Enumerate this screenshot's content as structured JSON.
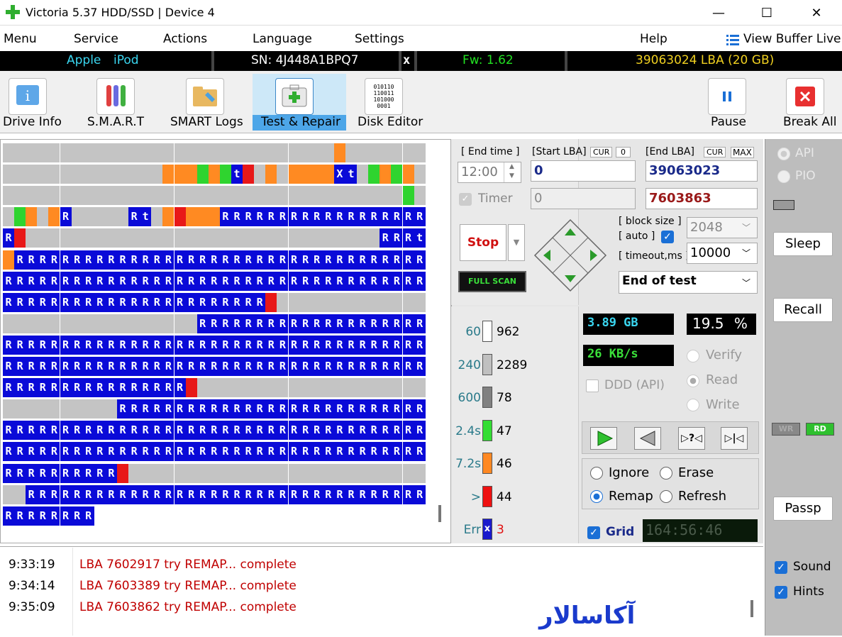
{
  "window": {
    "title": "Victoria 5.37 HDD/SSD | Device 4",
    "minimize": "—",
    "maximize": "☐",
    "close": "✕"
  },
  "menu": {
    "items": [
      "Menu",
      "Service",
      "Actions",
      "Language",
      "Settings",
      "Help"
    ],
    "view_buffer": "View Buffer Live"
  },
  "drive": {
    "vendor": "Apple",
    "model": "iPod",
    "serial": "SN: 4J448A1BPQ7",
    "close_x": "x",
    "firmware": "Fw: 1.62",
    "capacity": "39063024 LBA (20 GB)"
  },
  "toolbar": {
    "drive_info": "Drive Info",
    "smart": "S.M.A.R.T",
    "smart_logs": "SMART Logs",
    "test_repair": "Test & Repair",
    "disk_editor": "Disk Editor",
    "pause": "Pause",
    "break_all": "Break All",
    "disk_editor_icon_text": [
      "010110",
      "110011",
      "101000",
      "0001"
    ]
  },
  "controls": {
    "end_time_label": "[ End time ]",
    "end_time_value": "12:00",
    "timer_label": "Timer",
    "timer_value": "0",
    "start_lba_label": "[Start LBA]",
    "cur_label": "CUR",
    "cur_value": "0",
    "start_lba_value": "0",
    "end_lba_label": "[End LBA]",
    "end_cur_label": "CUR",
    "max_label": "MAX",
    "end_lba_value": "39063023",
    "current_lba_value": "7603863",
    "stop_label": "Stop",
    "full_scan_label": "FULL SCAN",
    "block_size_label": "[ block size ]",
    "auto_label": "[ auto ]",
    "block_size_value": "2048",
    "timeout_label": "[ timeout,ms ]",
    "timeout_value": "10000",
    "end_of_test": "End of test"
  },
  "legend": [
    {
      "threshold": "60",
      "count": "962",
      "color": "#ffffff"
    },
    {
      "threshold": "240",
      "count": "2289",
      "color": "#c0c0c0"
    },
    {
      "threshold": "600",
      "count": "78",
      "color": "#808080"
    },
    {
      "threshold": "2.4s",
      "count": "47",
      "color": "#33dd33"
    },
    {
      "threshold": "7.2s",
      "count": "46",
      "color": "#ff8822"
    },
    {
      "threshold": ">",
      "count": "44",
      "color": "#ee1111"
    },
    {
      "threshold": "Err",
      "count": "3",
      "color": "#1a1acc",
      "mark": "x"
    }
  ],
  "stats": {
    "size": "3.89 GB",
    "percent_value": "19.5",
    "percent_sign": "%",
    "speed": "26 KB/s",
    "ddd_label": "DDD (API)",
    "verify": "Verify",
    "read": "Read",
    "write": "Write",
    "ignore": "Ignore",
    "erase": "Erase",
    "remap": "Remap",
    "refresh": "Refresh",
    "grid_label": "Grid",
    "clock": "164:56:46"
  },
  "right": {
    "api": "API",
    "pio": "PIO",
    "sleep": "Sleep",
    "recall": "Recall",
    "wr": "WR",
    "rd": "RD",
    "passp": "Passp",
    "sound": "Sound",
    "hints": "Hints"
  },
  "log": [
    {
      "time": "9:33:19",
      "msg": "LBA 7602917 try REMAP... complete"
    },
    {
      "time": "9:34:14",
      "msg": "LBA 7603389 try REMAP... complete"
    },
    {
      "time": "9:35:09",
      "msg": "LBA 7603862 try REMAP... complete"
    }
  ],
  "watermark": "آکاسالار",
  "grid_rows": [
    "LLLLLLLLLLLLLLLLLLLLLLLLLLLLLOLLLLLLL",
    "LLLLLLLLLLLLLLOOOGOGtrLOLOOOOxtLGOGOL",
    "LLLLLLLLLLLLLLLLLLLLLLLLLLLLLLLLLLLGL",
    "LGOLORLLLLLRtLOrOOORRRRRRRRRRRRRRRRRR",
    "RrLLLLLLLLLLLLLLLLLLLLLLLLLLLLLLLRRRt",
    "ORRRRRRRRRRRRRRRRRRRRRRRRRRRRRRRRRRRR",
    "RRRRRRRRRRRRRRRRRRRRRRRRRRRRRRRRRRRRR",
    "RRRRRRRRRRRRRRRRRRRRRRRrLLLLLLLLLLLLL",
    "LLLLLLLLLLLLLLLLLRRRRRRRRRRRRRRRRRRRR",
    "RRRRRRRRRRRRRRRRRRRRRRRRRRRRRRRRRRRRR",
    "RRRRRRRRRRRRRRRRRRRRRRRRRRRRRRRRRRRRR",
    "RRRRRRRRRRRRRRRRrLLLLLLLLLLLLLLLLLLLL",
    "LLLLLLLLLLRRRRRRRRRRRRRRRRRRRRRRRRRRR",
    "RRRRRRRRRRRRRRRRRRRRRRRRRRRRRRRRRRRRR",
    "RRRRRRRRRRRRRRRRRRRRRRRRRRRRRRRRRRRRR",
    "RRRRRRRRRRrLLLLLLLLLLLLLLLLLLLLLLLLLL",
    "LLRRRRRRRRRRRRRRRRRRRRRRRRRRRRRRRRRRR",
    "RRRRRRRR"
  ]
}
